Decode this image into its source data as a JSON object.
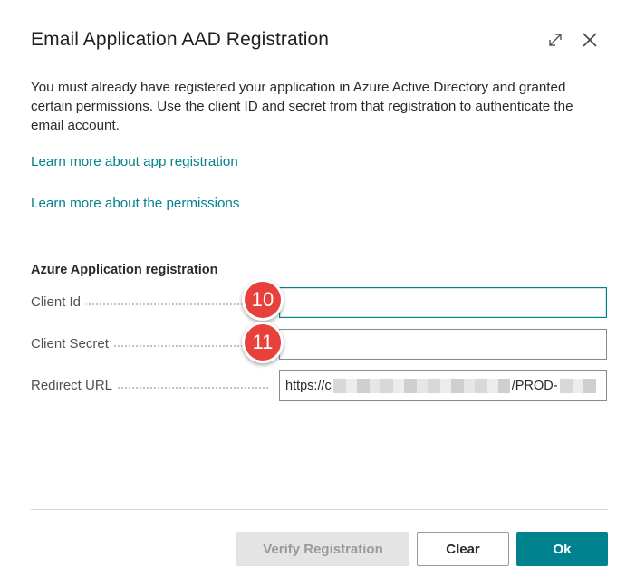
{
  "dialog": {
    "title": "Email Application AAD Registration",
    "description": "You must already have registered your application in Azure Active Directory and granted certain permissions. Use the client ID and secret from that registration to authenticate the email account.",
    "controls": {
      "expand_icon": "expand-icon",
      "close_icon": "close-icon"
    }
  },
  "links": {
    "app_registration": "Learn more about app registration",
    "permissions": "Learn more about the permissions"
  },
  "section": {
    "heading": "Azure Application registration"
  },
  "fields": {
    "client_id": {
      "label": "Client Id",
      "value": ""
    },
    "client_secret": {
      "label": "Client Secret",
      "value": ""
    },
    "redirect_url": {
      "label": "Redirect URL",
      "value_prefix": "https://c",
      "value_suffix": "/PROD-"
    }
  },
  "badges": {
    "client_id": "10",
    "client_secret": "11"
  },
  "buttons": {
    "verify": "Verify Registration",
    "clear": "Clear",
    "ok": "Ok"
  },
  "colors": {
    "accent": "#00838f",
    "badge": "#e8403a",
    "disabled_bg": "#e4e4e4"
  }
}
